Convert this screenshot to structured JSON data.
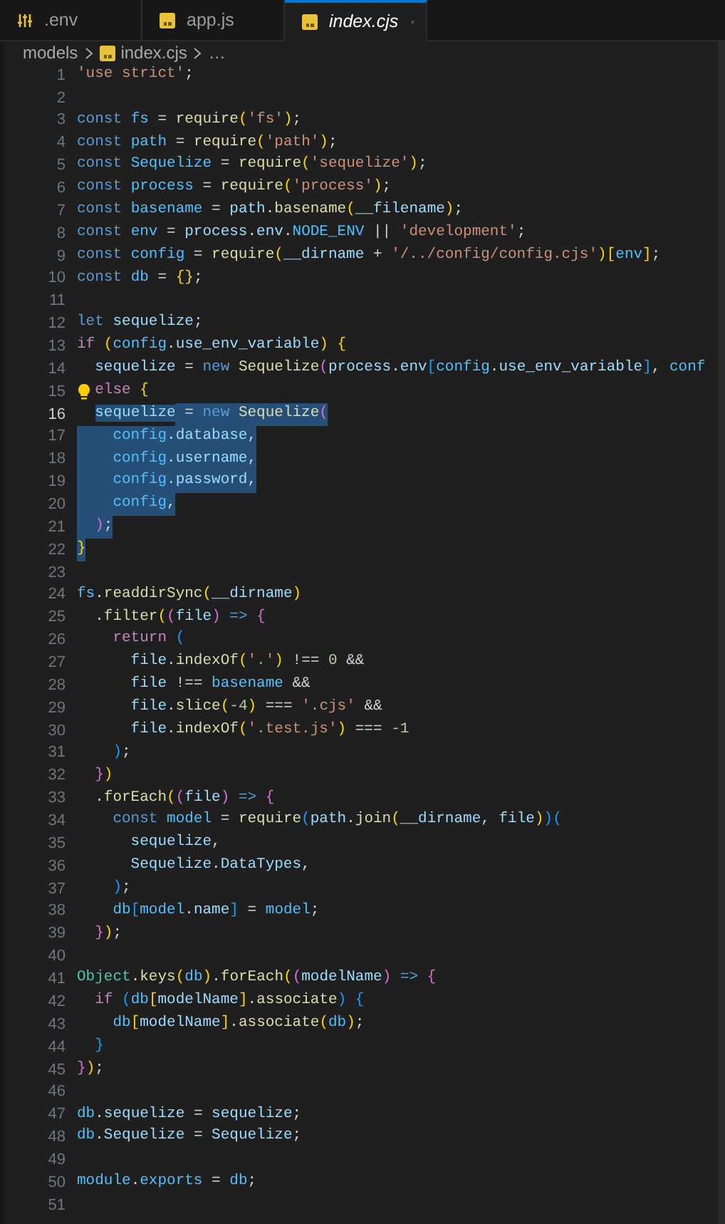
{
  "tabs": [
    {
      "label": ".env",
      "kind": "env",
      "selected": false
    },
    {
      "label": "app.js",
      "kind": "js",
      "selected": false
    },
    {
      "label": "index.cjs",
      "kind": "js",
      "selected": true
    }
  ],
  "breadcrumb": [
    {
      "label": "models",
      "kind": "folder"
    },
    {
      "label": "index.cjs",
      "kind": "js"
    },
    {
      "label": "…",
      "kind": "more"
    }
  ],
  "lines": [
    {
      "number": "1",
      "selected": false,
      "tokens": [
        {
          "text": "'use strict'",
          "kind": "string"
        },
        {
          "text": ";",
          "kind": "plain"
        }
      ]
    },
    {
      "number": "2",
      "selected": false
    },
    {
      "number": "3",
      "selected": false,
      "tokens": [
        {
          "text": "const ",
          "kind": "keyword"
        },
        {
          "text": "fs",
          "kind": "constant"
        },
        {
          "text": " = ",
          "kind": "plain"
        },
        {
          "text": "require",
          "kind": "function"
        },
        {
          "text": "(",
          "kind": "bracket1"
        },
        {
          "text": "'fs'",
          "kind": "string"
        },
        {
          "text": ")",
          "kind": "bracket1"
        },
        {
          "text": ";",
          "kind": "plain"
        }
      ]
    },
    {
      "number": "4",
      "selected": false,
      "tokens": [
        {
          "text": "const ",
          "kind": "keyword"
        },
        {
          "text": "path",
          "kind": "constant"
        },
        {
          "text": " = ",
          "kind": "plain"
        },
        {
          "text": "require",
          "kind": "function"
        },
        {
          "text": "(",
          "kind": "bracket1"
        },
        {
          "text": "'path'",
          "kind": "string"
        },
        {
          "text": ")",
          "kind": "bracket1"
        },
        {
          "text": ";",
          "kind": "plain"
        }
      ]
    },
    {
      "number": "5",
      "selected": false,
      "tokens": [
        {
          "text": "const ",
          "kind": "keyword"
        },
        {
          "text": "Sequelize",
          "kind": "constant"
        },
        {
          "text": " = ",
          "kind": "plain"
        },
        {
          "text": "require",
          "kind": "function"
        },
        {
          "text": "(",
          "kind": "bracket1"
        },
        {
          "text": "'sequelize'",
          "kind": "string"
        },
        {
          "text": ")",
          "kind": "bracket1"
        },
        {
          "text": ";",
          "kind": "plain"
        }
      ]
    },
    {
      "number": "6",
      "selected": false,
      "tokens": [
        {
          "text": "const ",
          "kind": "keyword"
        },
        {
          "text": "process",
          "kind": "constant"
        },
        {
          "text": " = ",
          "kind": "plain"
        },
        {
          "text": "require",
          "kind": "function"
        },
        {
          "text": "(",
          "kind": "bracket1"
        },
        {
          "text": "'process'",
          "kind": "string"
        },
        {
          "text": ")",
          "kind": "bracket1"
        },
        {
          "text": ";",
          "kind": "plain"
        }
      ]
    },
    {
      "number": "7",
      "selected": false,
      "tokens": [
        {
          "text": "const ",
          "kind": "keyword"
        },
        {
          "text": "basename",
          "kind": "constant"
        },
        {
          "text": " = ",
          "kind": "plain"
        },
        {
          "text": "path",
          "kind": "variable"
        },
        {
          "text": ".",
          "kind": "plain"
        },
        {
          "text": "basename",
          "kind": "function"
        },
        {
          "text": "(",
          "kind": "bracket1"
        },
        {
          "text": "__filename",
          "kind": "variable"
        },
        {
          "text": ")",
          "kind": "bracket1"
        },
        {
          "text": ";",
          "kind": "plain"
        }
      ]
    },
    {
      "number": "8",
      "selected": false,
      "tokens": [
        {
          "text": "const ",
          "kind": "keyword"
        },
        {
          "text": "env",
          "kind": "constant"
        },
        {
          "text": " = ",
          "kind": "plain"
        },
        {
          "text": "process",
          "kind": "variable"
        },
        {
          "text": ".",
          "kind": "plain"
        },
        {
          "text": "env",
          "kind": "variable"
        },
        {
          "text": ".",
          "kind": "plain"
        },
        {
          "text": "NODE_ENV",
          "kind": "constant"
        },
        {
          "text": " || ",
          "kind": "plain"
        },
        {
          "text": "'development'",
          "kind": "string"
        },
        {
          "text": ";",
          "kind": "plain"
        }
      ]
    },
    {
      "number": "9",
      "selected": false,
      "tokens": [
        {
          "text": "const ",
          "kind": "keyword"
        },
        {
          "text": "config",
          "kind": "constant"
        },
        {
          "text": " = ",
          "kind": "plain"
        },
        {
          "text": "require",
          "kind": "function"
        },
        {
          "text": "(",
          "kind": "bracket1"
        },
        {
          "text": "__dirname",
          "kind": "variable"
        },
        {
          "text": " + ",
          "kind": "plain"
        },
        {
          "text": "'/../config/config.cjs'",
          "kind": "string"
        },
        {
          "text": ")",
          "kind": "bracket1"
        },
        {
          "text": "[",
          "kind": "bracket1"
        },
        {
          "text": "env",
          "kind": "constant"
        },
        {
          "text": "]",
          "kind": "bracket1"
        },
        {
          "text": ";",
          "kind": "plain"
        }
      ]
    },
    {
      "number": "10",
      "selected": false,
      "tokens": [
        {
          "text": "const ",
          "kind": "keyword"
        },
        {
          "text": "db",
          "kind": "constant"
        },
        {
          "text": " = ",
          "kind": "plain"
        },
        {
          "text": "{}",
          "kind": "bracket1"
        },
        {
          "text": ";",
          "kind": "plain"
        }
      ]
    },
    {
      "number": "11",
      "selected": false
    },
    {
      "number": "12",
      "selected": false,
      "tokens": [
        {
          "text": "let ",
          "kind": "keyword"
        },
        {
          "text": "sequelize",
          "kind": "variable"
        },
        {
          "text": ";",
          "kind": "plain"
        }
      ]
    },
    {
      "number": "13",
      "selected": false,
      "tokens": [
        {
          "text": "if ",
          "kind": "control"
        },
        {
          "text": "(",
          "kind": "bracket1"
        },
        {
          "text": "config",
          "kind": "constant"
        },
        {
          "text": ".",
          "kind": "plain"
        },
        {
          "text": "use_env_variable",
          "kind": "variable"
        },
        {
          "text": ") ",
          "kind": "bracket1"
        },
        {
          "text": "{",
          "kind": "bracket1"
        }
      ]
    },
    {
      "number": "14",
      "selected": false,
      "tokens": [
        {
          "text": "  sequelize",
          "kind": "variable"
        },
        {
          "text": " = ",
          "kind": "plain"
        },
        {
          "text": "new ",
          "kind": "keyword"
        },
        {
          "text": "Sequelize",
          "kind": "function"
        },
        {
          "text": "(",
          "kind": "bracket2"
        },
        {
          "text": "process",
          "kind": "variable"
        },
        {
          "text": ".",
          "kind": "plain"
        },
        {
          "text": "env",
          "kind": "variable"
        },
        {
          "text": "[",
          "kind": "bracket3"
        },
        {
          "text": "config",
          "kind": "constant"
        },
        {
          "text": ".",
          "kind": "plain"
        },
        {
          "text": "use_env_variable",
          "kind": "variable"
        },
        {
          "text": "]",
          "kind": "bracket3"
        },
        {
          "text": ", ",
          "kind": "plain"
        },
        {
          "text": "conf",
          "kind": "constant"
        }
      ]
    },
    {
      "number": "15",
      "selected": false,
      "lightbulb": true,
      "tokens": [
        {
          "text": "else ",
          "kind": "control"
        },
        {
          "text": "{",
          "kind": "bracket1"
        }
      ]
    },
    {
      "number": "16",
      "selected": true,
      "current": true,
      "tokens": [
        {
          "text": "  sequelize",
          "kind": "variable"
        },
        {
          "text": " = ",
          "kind": "plain"
        },
        {
          "text": "new ",
          "kind": "keyword"
        },
        {
          "text": "Sequelize",
          "kind": "function"
        },
        {
          "text": "(",
          "kind": "bracket2"
        }
      ]
    },
    {
      "number": "17",
      "selected": true,
      "tokens": [
        {
          "text": "    config",
          "kind": "constant"
        },
        {
          "text": ".database",
          "kind": "variable"
        },
        {
          "text": ",",
          "kind": "plain"
        }
      ]
    },
    {
      "number": "18",
      "selected": true,
      "tokens": [
        {
          "text": "    config",
          "kind": "constant"
        },
        {
          "text": ".username",
          "kind": "variable"
        },
        {
          "text": ",",
          "kind": "plain"
        }
      ]
    },
    {
      "number": "19",
      "selected": true,
      "tokens": [
        {
          "text": "    config",
          "kind": "constant"
        },
        {
          "text": ".password",
          "kind": "variable"
        },
        {
          "text": ",",
          "kind": "plain"
        }
      ]
    },
    {
      "number": "20",
      "selected": true,
      "tokens": [
        {
          "text": "    config",
          "kind": "constant"
        },
        {
          "text": ",",
          "kind": "plain"
        }
      ]
    },
    {
      "number": "21",
      "selected": true,
      "tokens": [
        {
          "text": "  )",
          "kind": "bracket2"
        },
        {
          "text": ";",
          "kind": "plain"
        }
      ]
    },
    {
      "number": "22",
      "selected": true,
      "tokens": [
        {
          "text": "}",
          "kind": "bracket1"
        }
      ]
    },
    {
      "number": "23",
      "selected": false
    },
    {
      "number": "24",
      "selected": false,
      "tokens": [
        {
          "text": "fs",
          "kind": "constant"
        },
        {
          "text": ".",
          "kind": "plain"
        },
        {
          "text": "readdirSync",
          "kind": "function"
        },
        {
          "text": "(",
          "kind": "bracket1"
        },
        {
          "text": "__dirname",
          "kind": "variable"
        },
        {
          "text": ")",
          "kind": "bracket1"
        }
      ]
    },
    {
      "number": "25",
      "selected": false,
      "tokens": [
        {
          "text": "  .",
          "kind": "plain"
        },
        {
          "text": "filter",
          "kind": "function"
        },
        {
          "text": "(",
          "kind": "bracket1"
        },
        {
          "text": "(",
          "kind": "bracket2"
        },
        {
          "text": "file",
          "kind": "variable"
        },
        {
          "text": ")",
          "kind": "bracket2"
        },
        {
          "text": " => ",
          "kind": "keyword"
        },
        {
          "text": "{",
          "kind": "bracket2"
        }
      ]
    },
    {
      "number": "26",
      "selected": false,
      "tokens": [
        {
          "text": "    return ",
          "kind": "control"
        },
        {
          "text": "(",
          "kind": "bracket3"
        }
      ]
    },
    {
      "number": "27",
      "selected": false,
      "tokens": [
        {
          "text": "      file",
          "kind": "variable"
        },
        {
          "text": ".",
          "kind": "plain"
        },
        {
          "text": "indexOf",
          "kind": "function"
        },
        {
          "text": "(",
          "kind": "bracket1"
        },
        {
          "text": "'.'",
          "kind": "string"
        },
        {
          "text": ")",
          "kind": "bracket1"
        },
        {
          "text": " !== ",
          "kind": "plain"
        },
        {
          "text": "0",
          "kind": "number"
        },
        {
          "text": " &&",
          "kind": "plain"
        }
      ]
    },
    {
      "number": "28",
      "selected": false,
      "tokens": [
        {
          "text": "      file",
          "kind": "variable"
        },
        {
          "text": " !== ",
          "kind": "plain"
        },
        {
          "text": "basename",
          "kind": "constant"
        },
        {
          "text": " &&",
          "kind": "plain"
        }
      ]
    },
    {
      "number": "29",
      "selected": false,
      "tokens": [
        {
          "text": "      file",
          "kind": "variable"
        },
        {
          "text": ".",
          "kind": "plain"
        },
        {
          "text": "slice",
          "kind": "function"
        },
        {
          "text": "(",
          "kind": "bracket1"
        },
        {
          "text": "-4",
          "kind": "number"
        },
        {
          "text": ")",
          "kind": "bracket1"
        },
        {
          "text": " === ",
          "kind": "plain"
        },
        {
          "text": "'.cjs'",
          "kind": "string"
        },
        {
          "text": " &&",
          "kind": "plain"
        }
      ]
    },
    {
      "number": "30",
      "selected": false,
      "tokens": [
        {
          "text": "      file",
          "kind": "variable"
        },
        {
          "text": ".",
          "kind": "plain"
        },
        {
          "text": "indexOf",
          "kind": "function"
        },
        {
          "text": "(",
          "kind": "bracket1"
        },
        {
          "text": "'.test.js'",
          "kind": "string"
        },
        {
          "text": ")",
          "kind": "bracket1"
        },
        {
          "text": " === ",
          "kind": "plain"
        },
        {
          "text": "-1",
          "kind": "number"
        }
      ]
    },
    {
      "number": "31",
      "selected": false,
      "tokens": [
        {
          "text": "    )",
          "kind": "bracket3"
        },
        {
          "text": ";",
          "kind": "plain"
        }
      ]
    },
    {
      "number": "32",
      "selected": false,
      "tokens": [
        {
          "text": "  }",
          "kind": "bracket2"
        },
        {
          "text": ")",
          "kind": "bracket1"
        }
      ]
    },
    {
      "number": "33",
      "selected": false,
      "tokens": [
        {
          "text": "  .",
          "kind": "plain"
        },
        {
          "text": "forEach",
          "kind": "function"
        },
        {
          "text": "(",
          "kind": "bracket1"
        },
        {
          "text": "(",
          "kind": "bracket2"
        },
        {
          "text": "file",
          "kind": "variable"
        },
        {
          "text": ")",
          "kind": "bracket2"
        },
        {
          "text": " => ",
          "kind": "keyword"
        },
        {
          "text": "{",
          "kind": "bracket2"
        }
      ]
    },
    {
      "number": "34",
      "selected": false,
      "tokens": [
        {
          "text": "    const ",
          "kind": "keyword"
        },
        {
          "text": "model",
          "kind": "constant"
        },
        {
          "text": " = ",
          "kind": "plain"
        },
        {
          "text": "require",
          "kind": "function"
        },
        {
          "text": "(",
          "kind": "bracket3"
        },
        {
          "text": "path",
          "kind": "variable"
        },
        {
          "text": ".",
          "kind": "plain"
        },
        {
          "text": "join",
          "kind": "function"
        },
        {
          "text": "(",
          "kind": "bracket1"
        },
        {
          "text": "__dirname",
          "kind": "variable"
        },
        {
          "text": ", ",
          "kind": "plain"
        },
        {
          "text": "file",
          "kind": "variable"
        },
        {
          "text": ")",
          "kind": "bracket1"
        },
        {
          "text": ")",
          "kind": "bracket3"
        },
        {
          "text": "(",
          "kind": "bracket3"
        }
      ]
    },
    {
      "number": "35",
      "selected": false,
      "tokens": [
        {
          "text": "      sequelize",
          "kind": "variable"
        },
        {
          "text": ",",
          "kind": "plain"
        }
      ]
    },
    {
      "number": "36",
      "selected": false,
      "tokens": [
        {
          "text": "      Sequelize",
          "kind": "variable"
        },
        {
          "text": ".",
          "kind": "plain"
        },
        {
          "text": "DataTypes",
          "kind": "variable"
        },
        {
          "text": ",",
          "kind": "plain"
        }
      ]
    },
    {
      "number": "37",
      "selected": false,
      "tokens": [
        {
          "text": "    )",
          "kind": "bracket3"
        },
        {
          "text": ";",
          "kind": "plain"
        }
      ]
    },
    {
      "number": "38",
      "selected": false,
      "tokens": [
        {
          "text": "    db",
          "kind": "constant"
        },
        {
          "text": "[",
          "kind": "bracket3"
        },
        {
          "text": "model",
          "kind": "constant"
        },
        {
          "text": ".",
          "kind": "plain"
        },
        {
          "text": "name",
          "kind": "variable"
        },
        {
          "text": "]",
          "kind": "bracket3"
        },
        {
          "text": " = ",
          "kind": "plain"
        },
        {
          "text": "model",
          "kind": "constant"
        },
        {
          "text": ";",
          "kind": "plain"
        }
      ]
    },
    {
      "number": "39",
      "selected": false,
      "tokens": [
        {
          "text": "  }",
          "kind": "bracket2"
        },
        {
          "text": ")",
          "kind": "bracket1"
        },
        {
          "text": ";",
          "kind": "plain"
        }
      ]
    },
    {
      "number": "40",
      "selected": false
    },
    {
      "number": "41",
      "selected": false,
      "tokens": [
        {
          "text": "Object",
          "kind": "class"
        },
        {
          "text": ".",
          "kind": "plain"
        },
        {
          "text": "keys",
          "kind": "function"
        },
        {
          "text": "(",
          "kind": "bracket1"
        },
        {
          "text": "db",
          "kind": "constant"
        },
        {
          "text": ")",
          "kind": "bracket1"
        },
        {
          "text": ".",
          "kind": "plain"
        },
        {
          "text": "forEach",
          "kind": "function"
        },
        {
          "text": "(",
          "kind": "bracket1"
        },
        {
          "text": "(",
          "kind": "bracket2"
        },
        {
          "text": "modelName",
          "kind": "variable"
        },
        {
          "text": ")",
          "kind": "bracket2"
        },
        {
          "text": " => ",
          "kind": "keyword"
        },
        {
          "text": "{",
          "kind": "bracket2"
        }
      ]
    },
    {
      "number": "42",
      "selected": false,
      "tokens": [
        {
          "text": "  if ",
          "kind": "control"
        },
        {
          "text": "(",
          "kind": "bracket3"
        },
        {
          "text": "db",
          "kind": "constant"
        },
        {
          "text": "[",
          "kind": "bracket1"
        },
        {
          "text": "modelName",
          "kind": "variable"
        },
        {
          "text": "]",
          "kind": "bracket1"
        },
        {
          "text": ".",
          "kind": "plain"
        },
        {
          "text": "associate",
          "kind": "function"
        },
        {
          "text": ") ",
          "kind": "bracket3"
        },
        {
          "text": "{",
          "kind": "bracket3"
        }
      ]
    },
    {
      "number": "43",
      "selected": false,
      "tokens": [
        {
          "text": "    db",
          "kind": "constant"
        },
        {
          "text": "[",
          "kind": "bracket1"
        },
        {
          "text": "modelName",
          "kind": "variable"
        },
        {
          "text": "]",
          "kind": "bracket1"
        },
        {
          "text": ".",
          "kind": "plain"
        },
        {
          "text": "associate",
          "kind": "function"
        },
        {
          "text": "(",
          "kind": "bracket1"
        },
        {
          "text": "db",
          "kind": "constant"
        },
        {
          "text": ")",
          "kind": "bracket1"
        },
        {
          "text": ";",
          "kind": "plain"
        }
      ]
    },
    {
      "number": "44",
      "selected": false,
      "tokens": [
        {
          "text": "  }",
          "kind": "bracket3"
        }
      ]
    },
    {
      "number": "45",
      "selected": false,
      "tokens": [
        {
          "text": "}",
          "kind": "bracket2"
        },
        {
          "text": ")",
          "kind": "bracket1"
        },
        {
          "text": ";",
          "kind": "plain"
        }
      ]
    },
    {
      "number": "46",
      "selected": false
    },
    {
      "number": "47",
      "selected": false,
      "tokens": [
        {
          "text": "db",
          "kind": "constant"
        },
        {
          "text": ".",
          "kind": "plain"
        },
        {
          "text": "sequelize",
          "kind": "variable"
        },
        {
          "text": " = ",
          "kind": "plain"
        },
        {
          "text": "sequelize",
          "kind": "variable"
        },
        {
          "text": ";",
          "kind": "plain"
        }
      ]
    },
    {
      "number": "48",
      "selected": false,
      "tokens": [
        {
          "text": "db",
          "kind": "constant"
        },
        {
          "text": ".",
          "kind": "plain"
        },
        {
          "text": "Sequelize",
          "kind": "variable"
        },
        {
          "text": " = ",
          "kind": "plain"
        },
        {
          "text": "Sequelize",
          "kind": "variable"
        },
        {
          "text": ";",
          "kind": "plain"
        }
      ]
    },
    {
      "number": "49",
      "selected": false
    },
    {
      "number": "50",
      "selected": false,
      "tokens": [
        {
          "text": "module",
          "kind": "constant"
        },
        {
          "text": ".",
          "kind": "plain"
        },
        {
          "text": "exports",
          "kind": "constant"
        },
        {
          "text": " = ",
          "kind": "plain"
        },
        {
          "text": "db",
          "kind": "constant"
        },
        {
          "text": ";",
          "kind": "plain"
        }
      ]
    },
    {
      "number": "51",
      "selected": false
    }
  ]
}
